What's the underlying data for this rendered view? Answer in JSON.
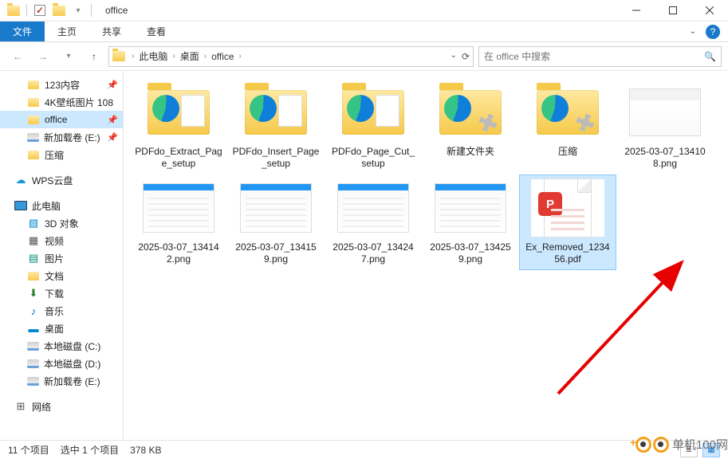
{
  "window": {
    "title": "office"
  },
  "ribbon": {
    "file": "文件",
    "tabs": [
      "主页",
      "共享",
      "查看"
    ]
  },
  "breadcrumb": {
    "items": [
      "此电脑",
      "桌面",
      "office"
    ]
  },
  "search": {
    "placeholder": "在 office 中搜索"
  },
  "tree": {
    "quick": [
      {
        "label": "123内容",
        "icon": "folder",
        "pinned": true
      },
      {
        "label": "4K壁纸图片 108",
        "icon": "folder",
        "pinned": true
      },
      {
        "label": "office",
        "icon": "folder",
        "pinned": true,
        "selected": true
      },
      {
        "label": "新加载卷 (E:)",
        "icon": "disk",
        "pinned": true
      },
      {
        "label": "压缩",
        "icon": "folder",
        "pinned": false
      }
    ],
    "wps": {
      "label": "WPS云盘",
      "icon": "wps"
    },
    "pc": {
      "label": "此电脑",
      "icon": "monitor"
    },
    "pc_children": [
      {
        "label": "3D 对象",
        "icon": "obj3d"
      },
      {
        "label": "视频",
        "icon": "vid"
      },
      {
        "label": "图片",
        "icon": "pic"
      },
      {
        "label": "文档",
        "icon": "folder"
      },
      {
        "label": "下载",
        "icon": "dl"
      },
      {
        "label": "音乐",
        "icon": "music"
      },
      {
        "label": "桌面",
        "icon": "desk"
      },
      {
        "label": "本地磁盘 (C:)",
        "icon": "disk"
      },
      {
        "label": "本地磁盘 (D:)",
        "icon": "disk"
      },
      {
        "label": "新加载卷 (E:)",
        "icon": "disk"
      }
    ],
    "network": {
      "label": "网络",
      "icon": "net"
    }
  },
  "items": [
    {
      "type": "folder-edge",
      "label": "PDFdo_Extract_Page_setup"
    },
    {
      "type": "folder-edge",
      "label": "PDFdo_Insert_Page_setup"
    },
    {
      "type": "folder-edge",
      "label": "PDFdo_Page_Cut_setup"
    },
    {
      "type": "folder-gear",
      "label": "新建文件夹"
    },
    {
      "type": "folder-gear",
      "label": "压缩"
    },
    {
      "type": "image",
      "label": "2025-03-07_134108.png"
    },
    {
      "type": "screenshot",
      "label": "2025-03-07_134142.png"
    },
    {
      "type": "screenshot",
      "label": "2025-03-07_134159.png"
    },
    {
      "type": "screenshot",
      "label": "2025-03-07_134247.png"
    },
    {
      "type": "screenshot",
      "label": "2025-03-07_134259.png"
    },
    {
      "type": "pdf",
      "label": "Ex_Removed_123456.pdf",
      "selected": true
    }
  ],
  "status": {
    "count": "11 个项目",
    "selection": "选中 1 个项目",
    "size": "378 KB"
  },
  "watermark": "单机100网"
}
